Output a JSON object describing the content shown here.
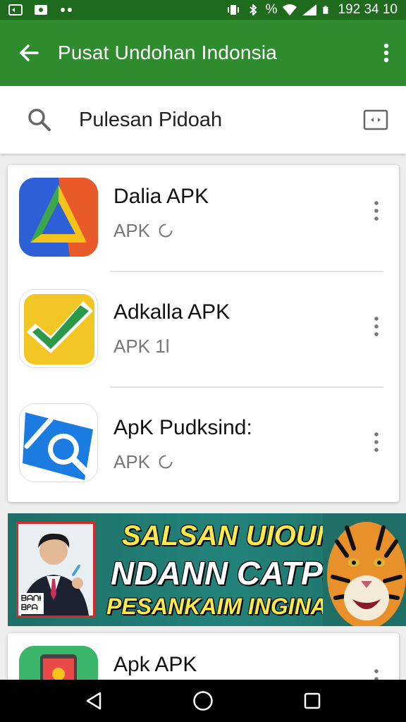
{
  "status_bar": {
    "time": "192 34 10",
    "battery_text": "%"
  },
  "app_bar": {
    "title": "Pusat Undohan Indonsia"
  },
  "search": {
    "query": "Pulesan Pidoah"
  },
  "apps": [
    {
      "name": "Dalia APK",
      "subtitle": "APK",
      "badge": "3",
      "icon": "triangle-app-icon"
    },
    {
      "name": "Adkalla APK",
      "subtitle": "APK 1l",
      "icon": "check-app-icon"
    },
    {
      "name": "ApK Pudksind:",
      "subtitle": "APK",
      "badge": "3",
      "icon": "magnifier-app-icon"
    }
  ],
  "banner": {
    "line1": "SALSAN UIOUME",
    "line2": "NDANN CATPS",
    "line3": "PESANKAIM INGINAIINI",
    "photo_caption": "ᗷᗩᑎƗ ᗷᑭᗩ"
  },
  "partial_item": {
    "name": "Apk APK"
  },
  "colors": {
    "app_bar": "#2e8b2e",
    "status_bar": "#1e6b1e",
    "banner_bg": "#22837a",
    "banner_text": "#ffe84a"
  }
}
